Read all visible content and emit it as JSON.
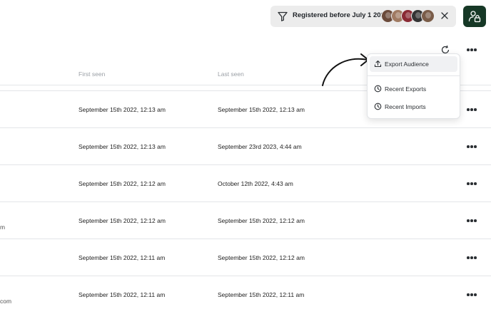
{
  "filter_chip": {
    "label": "Registered before July 1 2024",
    "avatar_colors": [
      "#6b4a3a",
      "#a07a62",
      "#8a2a34",
      "#343434",
      "#7a5c48"
    ]
  },
  "icons": {
    "filter": "funnel-icon",
    "close": "close-icon",
    "profile": "user-lock-icon",
    "refresh": "refresh-icon",
    "more": "more-horizontal-icon",
    "export": "upload-icon",
    "history": "clock-icon"
  },
  "colors": {
    "profile_button": "#163826",
    "chip_background": "#ececec",
    "header_text": "#9ba0a6"
  },
  "table": {
    "columns": [
      "First seen",
      "Last seen"
    ],
    "rows": [
      {
        "first_seen": "September 15th 2022, 12:13 am",
        "last_seen": "September 15th 2022, 12:13 am",
        "left_fragment": ""
      },
      {
        "first_seen": "September 15th 2022, 12:13 am",
        "last_seen": "September 23rd 2023, 4:44 am",
        "left_fragment": ""
      },
      {
        "first_seen": "September 15th 2022, 12:12 am",
        "last_seen": "October 12th 2022, 4:43 am",
        "left_fragment": ""
      },
      {
        "first_seen": "September 15th 2022, 12:12 am",
        "last_seen": "September 15th 2022, 12:12 am",
        "left_fragment": "m"
      },
      {
        "first_seen": "September 15th 2022, 12:11 am",
        "last_seen": "September 15th 2022, 12:12 am",
        "left_fragment": ""
      },
      {
        "first_seen": "September 15th 2022, 12:11 am",
        "last_seen": "September 15th 2022, 12:11 am",
        "left_fragment": "com"
      }
    ]
  },
  "menu": {
    "items": [
      {
        "label": "Export Audience",
        "icon": "upload-icon",
        "highlighted": true
      },
      {
        "label": "Recent Exports",
        "icon": "clock-icon",
        "highlighted": false
      },
      {
        "label": "Recent Imports",
        "icon": "clock-icon",
        "highlighted": false
      }
    ]
  }
}
